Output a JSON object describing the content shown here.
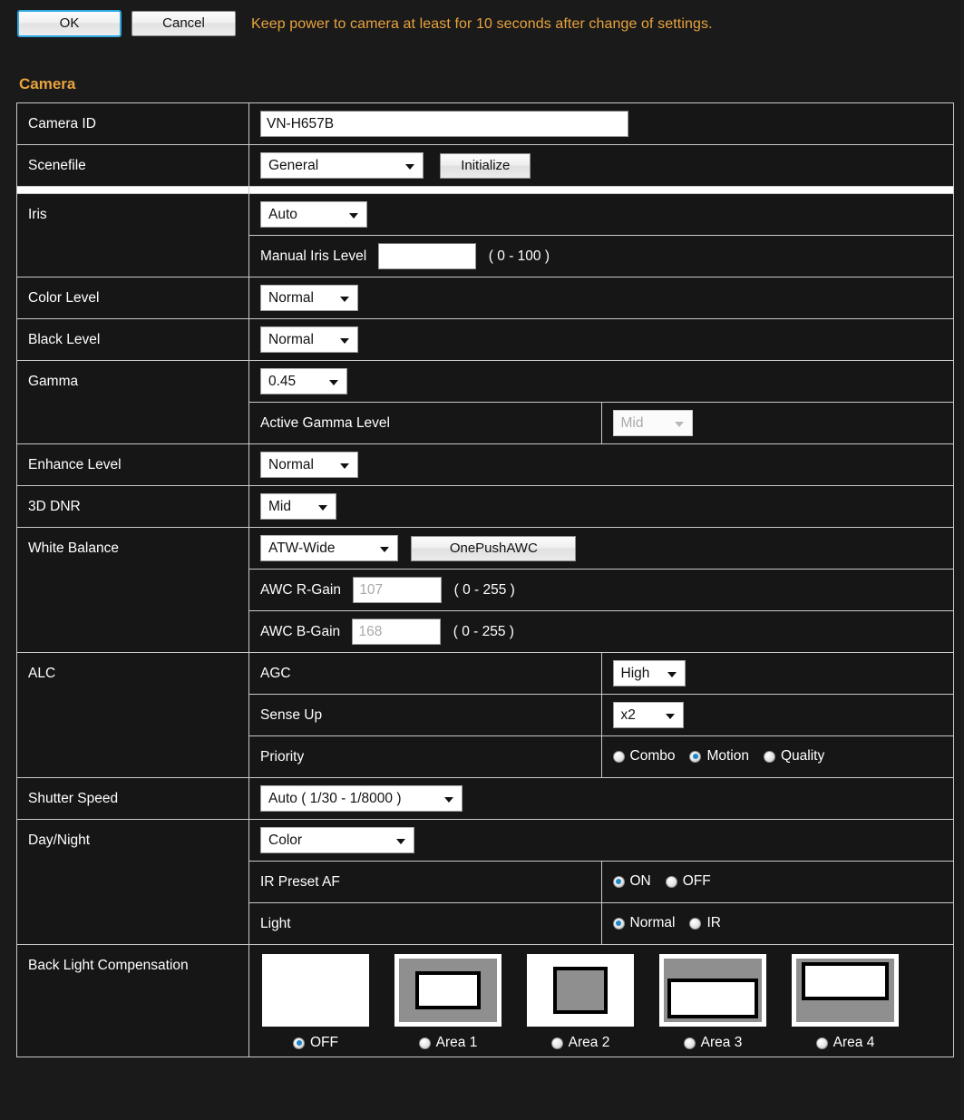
{
  "toolbar": {
    "ok_label": "OK",
    "cancel_label": "Cancel",
    "notice": "Keep power to camera at least for 10 seconds after change of settings."
  },
  "section": {
    "title": "Camera"
  },
  "colors": {
    "accent_text": "#e8a33d",
    "background": "#1a1a1a",
    "table_border": "#c9c9c9",
    "radio_selected": "#1f86c8",
    "focus_ring": "#2fa8e0"
  },
  "rows": {
    "camera_id": {
      "label": "Camera ID",
      "value": "VN-H657B"
    },
    "scenefile": {
      "label": "Scenefile",
      "value": "General",
      "button": "Initialize"
    },
    "iris": {
      "label": "Iris",
      "value": "Auto",
      "manual_label": "Manual Iris Level",
      "manual_value": "",
      "manual_range": "( 0 - 100 )"
    },
    "color_level": {
      "label": "Color Level",
      "value": "Normal"
    },
    "black_level": {
      "label": "Black Level",
      "value": "Normal"
    },
    "gamma": {
      "label": "Gamma",
      "value": "0.45",
      "active_label": "Active Gamma Level",
      "active_value": "Mid"
    },
    "enhance": {
      "label": "Enhance Level",
      "value": "Normal"
    },
    "dnr": {
      "label": "3D DNR",
      "value": "Mid"
    },
    "white_balance": {
      "label": "White Balance",
      "value": "ATW-Wide",
      "button": "OnePushAWC",
      "r_gain_label": "AWC R-Gain",
      "r_gain_value": "107",
      "r_gain_range": "( 0 - 255 )",
      "b_gain_label": "AWC B-Gain",
      "b_gain_value": "168",
      "b_gain_range": "( 0 - 255 )"
    },
    "alc": {
      "label": "ALC",
      "agc_label": "AGC",
      "agc_value": "High",
      "sense_up_label": "Sense Up",
      "sense_up_value": "x2",
      "priority_label": "Priority",
      "priority_options": [
        {
          "label": "Combo",
          "selected": false
        },
        {
          "label": "Motion",
          "selected": true
        },
        {
          "label": "Quality",
          "selected": false
        }
      ]
    },
    "shutter": {
      "label": "Shutter Speed",
      "value": "Auto ( 1/30 - 1/8000 )"
    },
    "day_night": {
      "label": "Day/Night",
      "value": "Color",
      "ir_preset_label": "IR Preset AF",
      "ir_preset_options": [
        {
          "label": "ON",
          "selected": true
        },
        {
          "label": "OFF",
          "selected": false
        }
      ],
      "light_label": "Light",
      "light_options": [
        {
          "label": "Normal",
          "selected": true
        },
        {
          "label": "IR",
          "selected": false
        }
      ]
    },
    "blc": {
      "label": "Back Light Compensation",
      "options": [
        {
          "label": "OFF",
          "selected": true,
          "pattern": "none"
        },
        {
          "label": "Area 1",
          "selected": false,
          "pattern": "center"
        },
        {
          "label": "Area 2",
          "selected": false,
          "pattern": "center-gray"
        },
        {
          "label": "Area 3",
          "selected": false,
          "pattern": "bottom"
        },
        {
          "label": "Area 4",
          "selected": false,
          "pattern": "top"
        }
      ]
    }
  }
}
